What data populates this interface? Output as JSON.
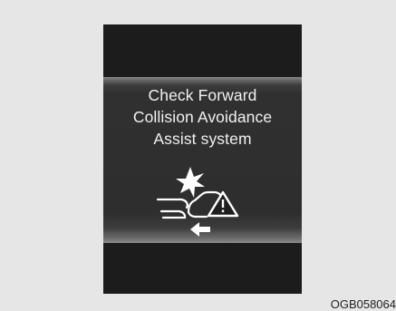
{
  "display": {
    "message_lines": [
      "Check Forward",
      "Collision Avoidance",
      "Assist system"
    ],
    "icon": "forward-collision-warning-icon"
  },
  "caption": "OGB058064"
}
